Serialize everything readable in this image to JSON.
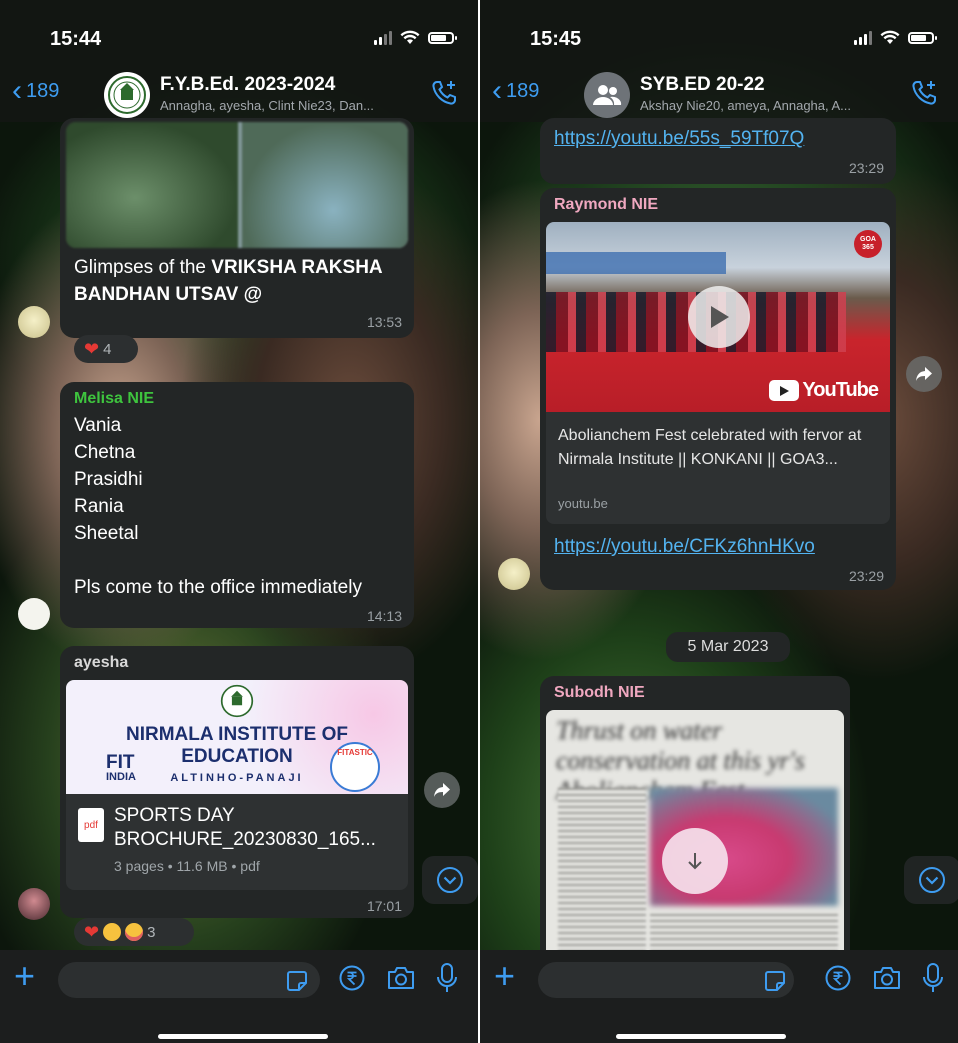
{
  "left": {
    "status": {
      "time": "15:44"
    },
    "header": {
      "back_count": "189",
      "title": "F.Y.B.Ed. 2023-2024",
      "subtitle": "Annagha, ayesha, Clint Nie23, Dan..."
    },
    "msg1": {
      "text_prefix": "Glimpses of the ",
      "text_bold": "VRIKSHA RAKSHA BANDHAN UTSAV @",
      "time": "13:53",
      "reaction_count": "4"
    },
    "msg2": {
      "sender": "Melisa NIE",
      "lines": [
        "Vania",
        "Chetna",
        "Prasidhi",
        "Rania",
        "Sheetal"
      ],
      "note": "Pls come to the office immediately",
      "time": "14:13"
    },
    "msg3": {
      "sender": "ayesha",
      "banner": {
        "line1": "NIRMALA INSTITUTE OF",
        "line2": "EDUCATION",
        "place": "ALTINHO-PANAJI",
        "fit": "FIT",
        "india": "INDIA",
        "fitastic": "FITASTIC"
      },
      "doc_icon": "pdf",
      "doc_title": "SPORTS DAY BROCHURE_20230830_165...",
      "doc_meta": "3 pages • 11.6 MB • pdf",
      "time": "17:01",
      "reaction_count": "3"
    }
  },
  "right": {
    "status": {
      "time": "15:45"
    },
    "header": {
      "back_count": "189",
      "title": "SYB.ED 20-22",
      "subtitle": "Akshay Nie20, ameya, Annagha, A..."
    },
    "msg1": {
      "link": "https://youtu.be/55s_59Tf07Q",
      "time": "23:29"
    },
    "msg2": {
      "sender": "Raymond NIE",
      "preview_title": "Abolianchem Fest celebrated with fervor at Nirmala Institute || KONKANI || GOA3...",
      "preview_domain": "youtu.be",
      "youtube_label": "YouTube",
      "channel_badge": "GOA 365",
      "link": "https://youtu.be/CFKz6hnHKvo",
      "time": "23:29"
    },
    "date_divider": "5 Mar 2023",
    "msg3": {
      "sender": "Subodh NIE",
      "blurred_headline": "Thrust on water conservation at this yr's Abolianchem Fest"
    }
  },
  "colors": {
    "accent": "#3e9cf0",
    "bubble": "#232626",
    "melisa": "#3ec43e",
    "raymond": "#f0a8c0",
    "subodh": "#f0a8c0",
    "link": "#53b3f0"
  },
  "icons": [
    "back-chevron-icon",
    "group-avatar-icon",
    "add-call-icon",
    "heart-icon",
    "forward-icon",
    "scroll-down-icon",
    "plus-icon",
    "sticker-icon",
    "rupee-icon",
    "camera-icon",
    "microphone-icon",
    "pdf-icon",
    "play-icon",
    "download-icon"
  ]
}
